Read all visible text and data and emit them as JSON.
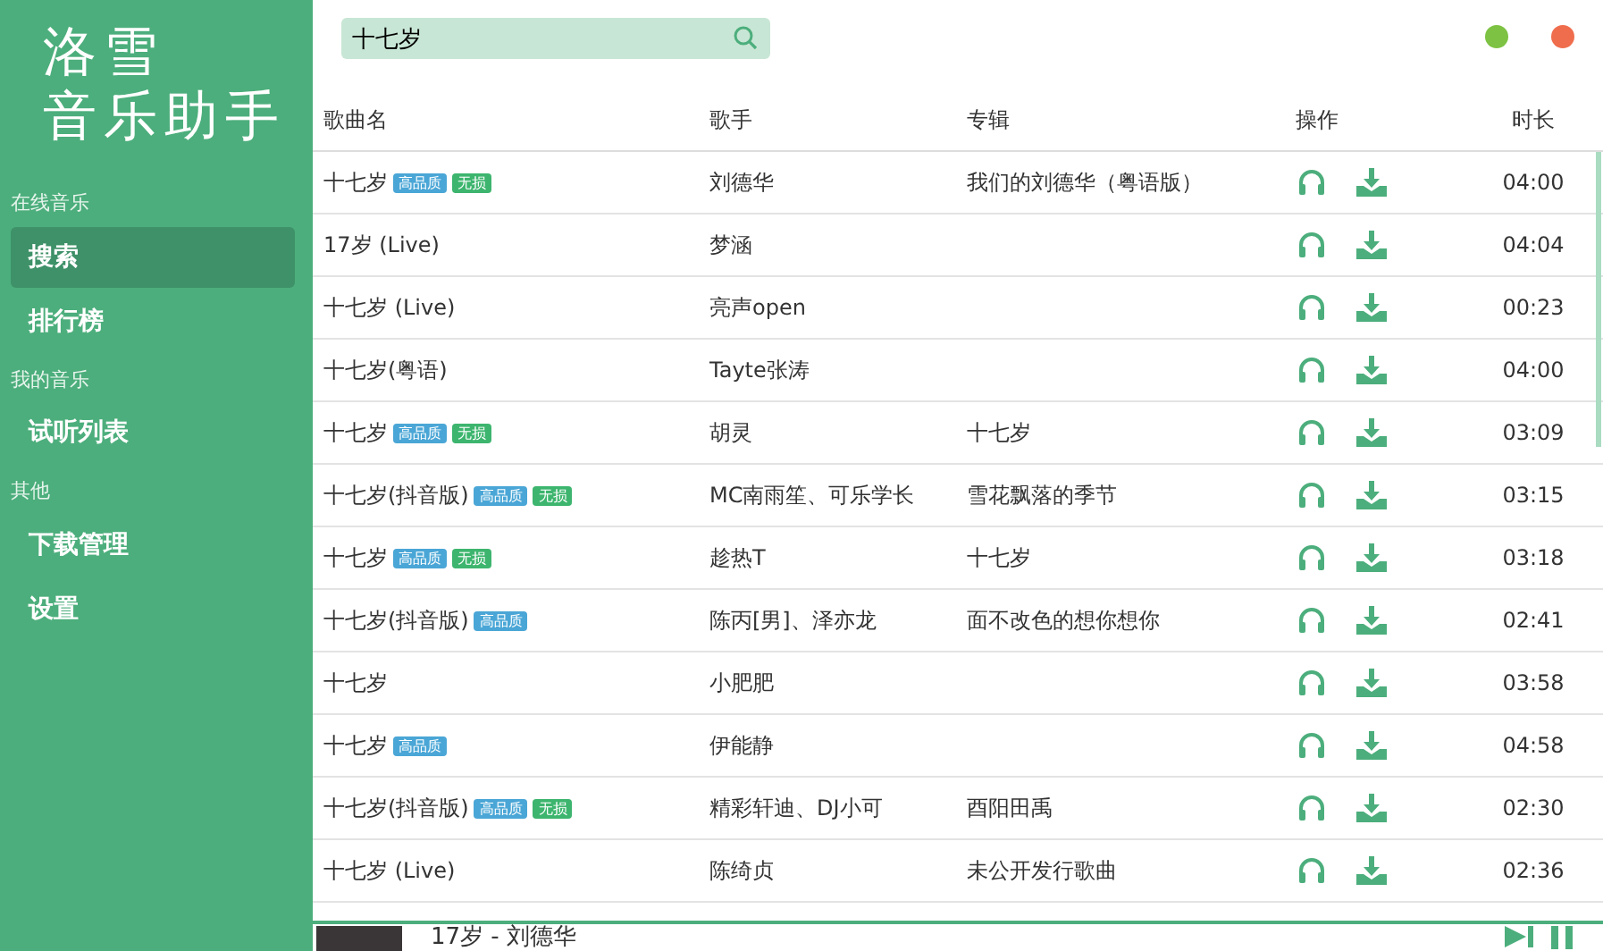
{
  "sidebar": {
    "logo": [
      "洛雪",
      "音乐助手"
    ],
    "groups": [
      {
        "title": "在线音乐",
        "items": [
          {
            "label": "搜索",
            "selected": true
          },
          {
            "label": "排行榜",
            "selected": false
          }
        ]
      },
      {
        "title": "我的音乐",
        "items": [
          {
            "label": "试听列表",
            "selected": false
          }
        ]
      },
      {
        "title": "其他",
        "items": [
          {
            "label": "下载管理",
            "selected": false
          },
          {
            "label": "设置",
            "selected": false
          }
        ]
      }
    ]
  },
  "search": {
    "value": "十七岁"
  },
  "window_controls": [
    {
      "color": "#7dc242"
    },
    {
      "color": "#ef6d4d"
    }
  ],
  "table": {
    "columns": [
      "歌曲名",
      "歌手",
      "专辑",
      "操作",
      "时长"
    ],
    "rows": [
      {
        "name": "十七岁",
        "tags": [
          {
            "label": "高品质",
            "kind": "hq"
          },
          {
            "label": "无损",
            "kind": "lossless"
          }
        ],
        "singer": "刘德华",
        "album": "我们的刘德华（粤语版）",
        "duration": "04:00"
      },
      {
        "name": "17岁 (Live)",
        "tags": [],
        "singer": "梦涵",
        "album": "",
        "duration": "04:04"
      },
      {
        "name": "十七岁 (Live)",
        "tags": [],
        "singer": "亮声open",
        "album": "",
        "duration": "00:23"
      },
      {
        "name": "十七岁(粤语)",
        "tags": [],
        "singer": "Tayte张涛",
        "album": "",
        "duration": "04:00"
      },
      {
        "name": "十七岁",
        "tags": [
          {
            "label": "高品质",
            "kind": "hq"
          },
          {
            "label": "无损",
            "kind": "lossless"
          }
        ],
        "singer": "胡灵",
        "album": "十七岁",
        "duration": "03:09"
      },
      {
        "name": "十七岁(抖音版)",
        "tags": [
          {
            "label": "高品质",
            "kind": "hq"
          },
          {
            "label": "无损",
            "kind": "lossless"
          }
        ],
        "singer": "MC南雨笙、可乐学长",
        "album": "雪花飘落的季节",
        "duration": "03:15"
      },
      {
        "name": "十七岁",
        "tags": [
          {
            "label": "高品质",
            "kind": "hq"
          },
          {
            "label": "无损",
            "kind": "lossless"
          }
        ],
        "singer": "趁热T",
        "album": "十七岁",
        "duration": "03:18"
      },
      {
        "name": "十七岁(抖音版)",
        "tags": [
          {
            "label": "高品质",
            "kind": "hq"
          }
        ],
        "singer": "陈丙[男]、泽亦龙",
        "album": "面不改色的想你想你",
        "duration": "02:41"
      },
      {
        "name": "十七岁",
        "tags": [],
        "singer": "小肥肥",
        "album": "",
        "duration": "03:58"
      },
      {
        "name": "十七岁",
        "tags": [
          {
            "label": "高品质",
            "kind": "hq"
          }
        ],
        "singer": "伊能静",
        "album": "",
        "duration": "04:58"
      },
      {
        "name": "十七岁(抖音版)",
        "tags": [
          {
            "label": "高品质",
            "kind": "hq"
          },
          {
            "label": "无损",
            "kind": "lossless"
          }
        ],
        "singer": "精彩轩迪、DJ小可",
        "album": "酉阳田禹",
        "duration": "02:30"
      },
      {
        "name": "十七岁 (Live)",
        "tags": [],
        "singer": "陈绮贞",
        "album": "未公开发行歌曲",
        "duration": "02:36"
      }
    ]
  },
  "player": {
    "title": "17岁 - 刘德华"
  }
}
